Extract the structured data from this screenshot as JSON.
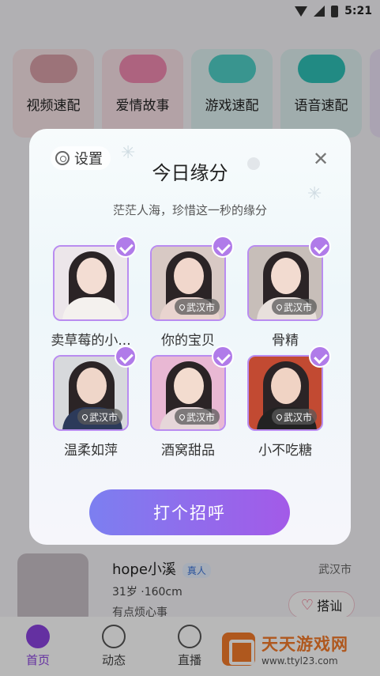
{
  "status_bar": {
    "time": "5:21"
  },
  "categories": [
    {
      "label": "视频速配"
    },
    {
      "label": "爱情故事"
    },
    {
      "label": "游戏速配"
    },
    {
      "label": "语音速配"
    }
  ],
  "background_rows": [
    {
      "name": "hope小溪",
      "badge": "真人",
      "info": "31岁 ·160cm",
      "desc": "有点烦心事",
      "city": "武汉市",
      "greet": "搭讪"
    }
  ],
  "tabs": [
    {
      "label": "首页"
    },
    {
      "label": "动态"
    },
    {
      "label": "直播"
    }
  ],
  "watermark": {
    "title": "天天游戏网",
    "url": "www.ttyl23.com"
  },
  "modal": {
    "settings_label": "设置",
    "close_symbol": "✕",
    "title": "今日缘分",
    "subtitle": "茫茫人海，珍惜这一秒的缘分",
    "cards": [
      {
        "name": "卖草莓的小...",
        "city": "",
        "skin": "#f3ddd3",
        "cloth": "#f4f1ee",
        "bg": "#ece6ea"
      },
      {
        "name": "你的宝贝",
        "city": "武汉市",
        "skin": "#f1d7cc",
        "cloth": "#e9d4cf",
        "bg": "#d8c9c4"
      },
      {
        "name": "骨精",
        "city": "武汉市",
        "skin": "#f2dbd0",
        "cloth": "#e8e0dc",
        "bg": "#c7beb9"
      },
      {
        "name": "温柔如萍",
        "city": "武汉市",
        "skin": "#efd6c9",
        "cloth": "#2c3a5a",
        "bg": "#d7d9dc"
      },
      {
        "name": "酒窝甜品",
        "city": "武汉市",
        "skin": "#f3dccf",
        "cloth": "#e6d6d9",
        "bg": "#e9b8d4"
      },
      {
        "name": "小不吃糖",
        "city": "武汉市",
        "skin": "#f0d3c4",
        "cloth": "#222222",
        "bg": "#c24a32"
      }
    ],
    "button_label": "打个招呼"
  }
}
